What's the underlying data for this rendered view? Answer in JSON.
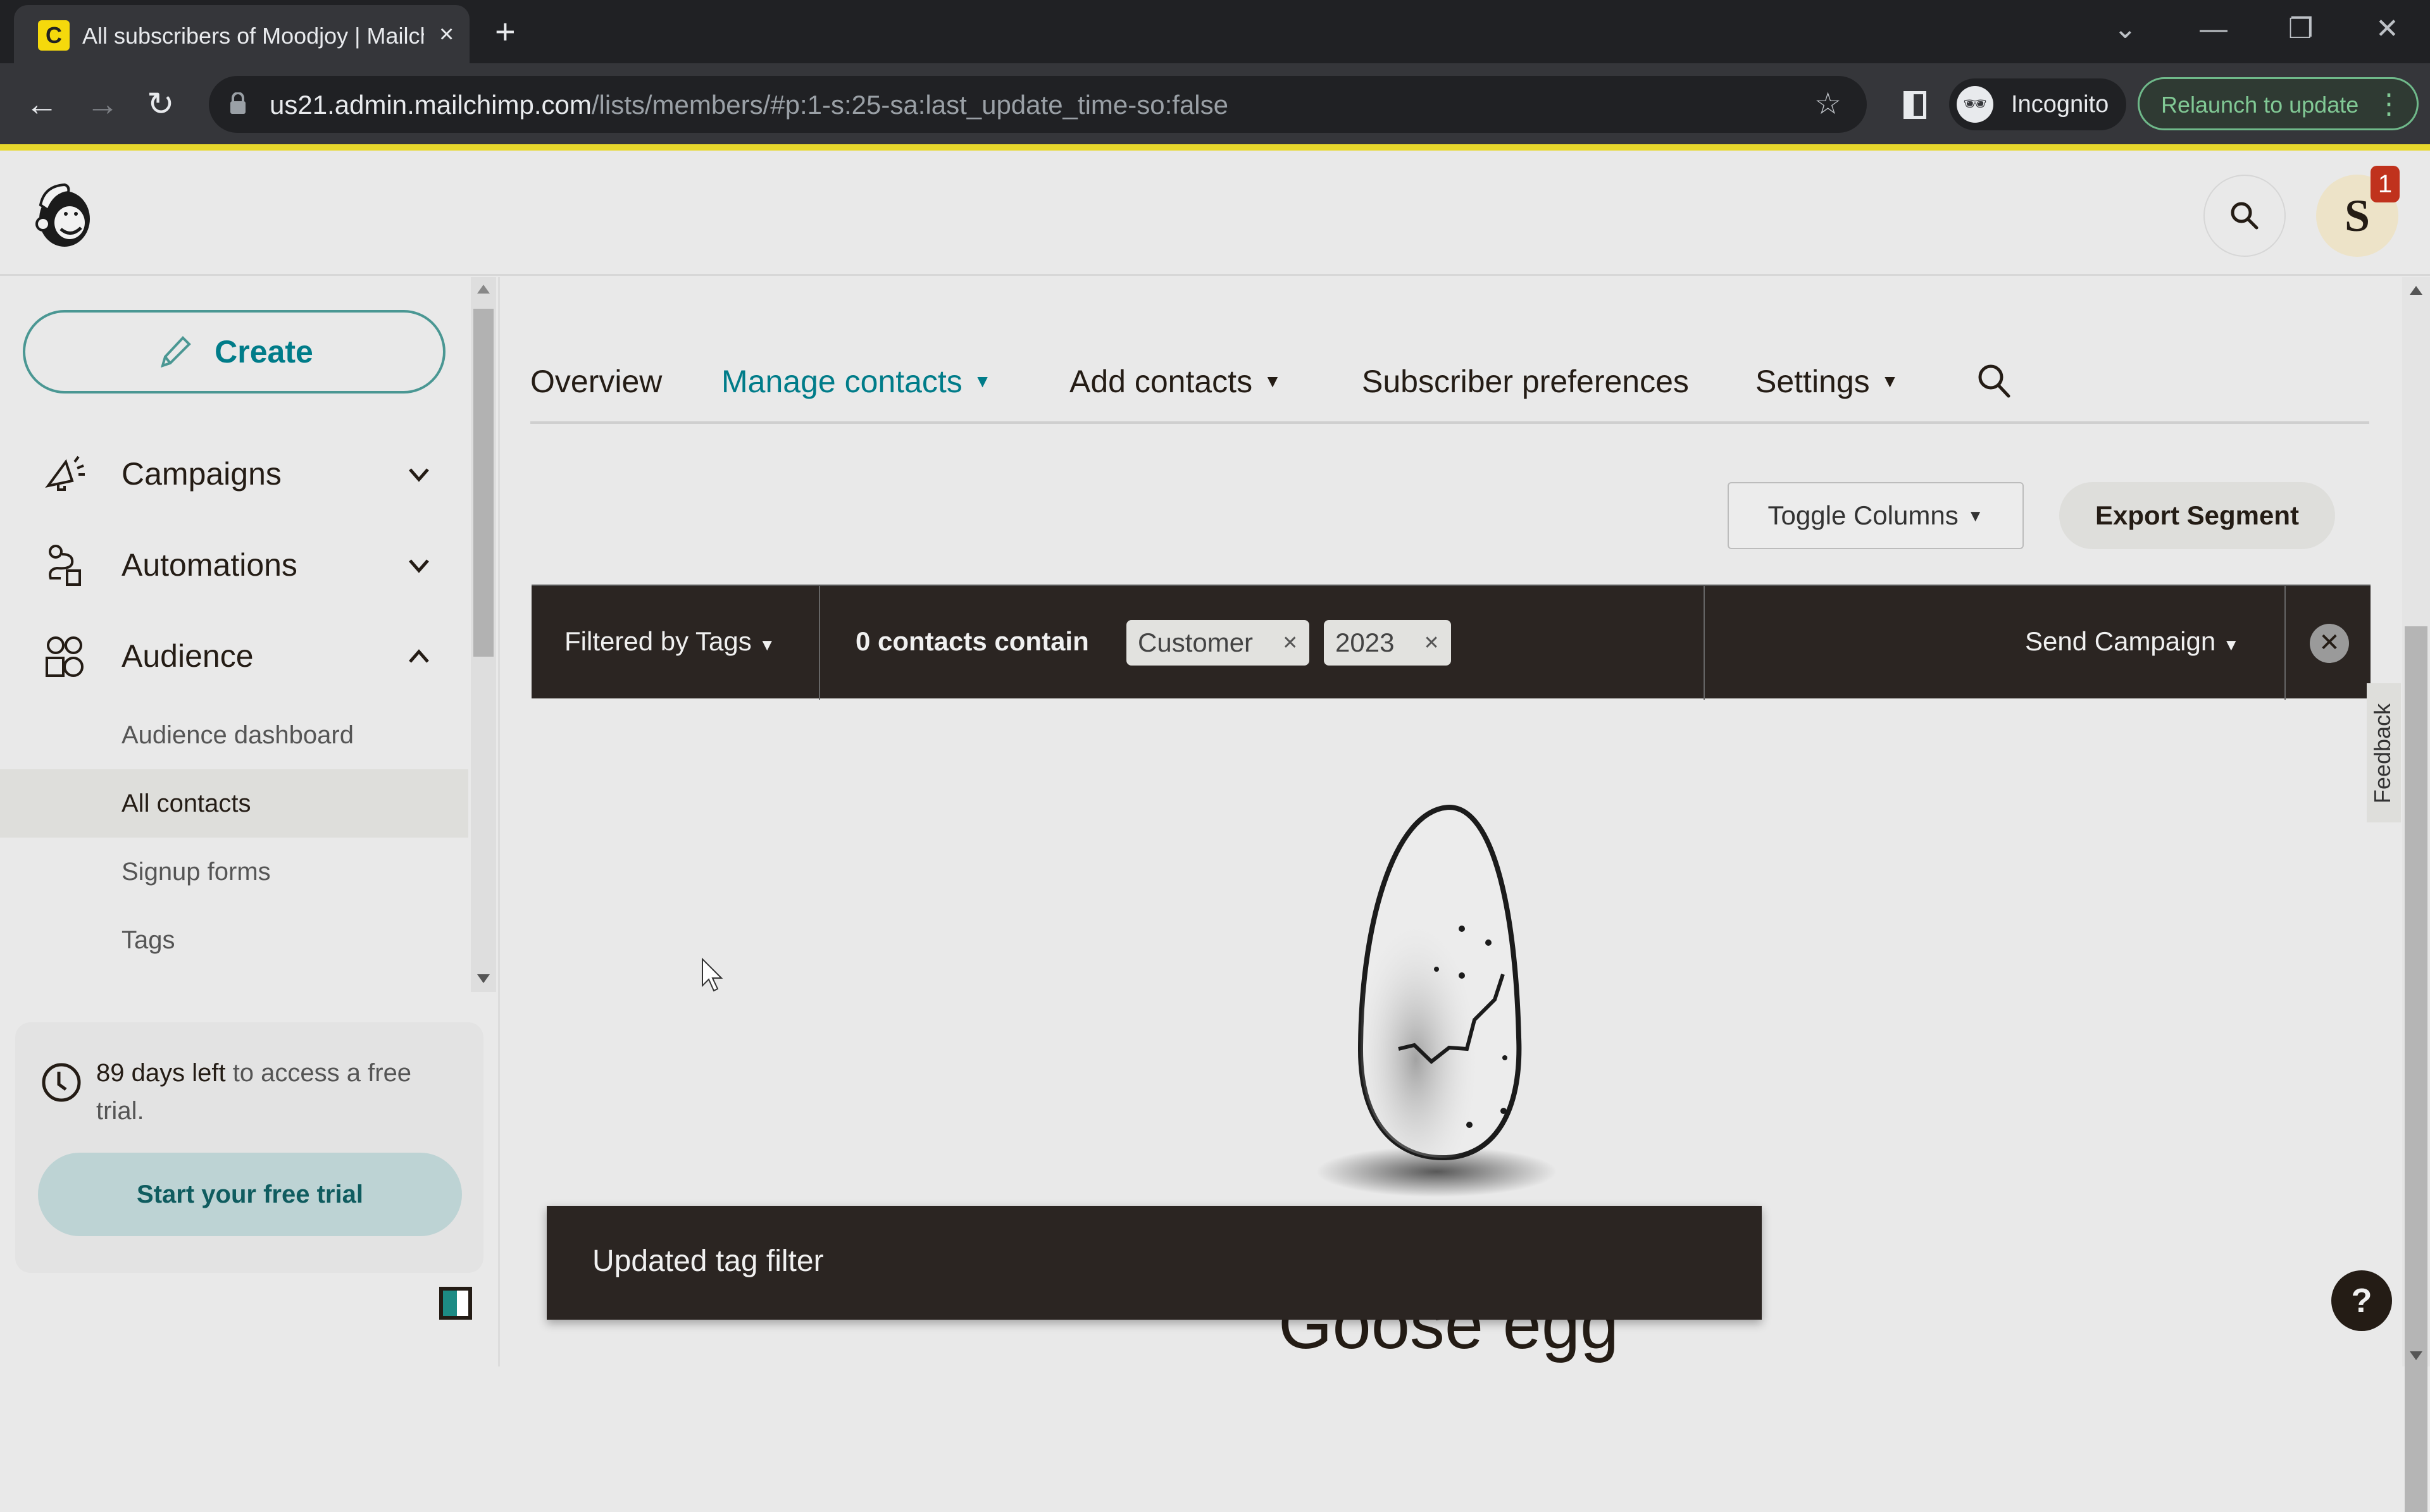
{
  "browser": {
    "tab_title": "All subscribers of Moodjoy | Mailchimp",
    "new_tab_label": "+",
    "url_host": "us21.admin.mailchimp.com",
    "url_path": "/lists/members/#p:1-s:25-sa:last_update_time-so:false",
    "incognito_label": "Incognito",
    "relaunch_label": "Relaunch to update",
    "accent_color": "#e7d82c"
  },
  "header": {
    "avatar_initial": "S",
    "notification_count": "1"
  },
  "sidebar": {
    "create_label": "Create",
    "nav": [
      {
        "label": "Campaigns",
        "icon": "megaphone-icon",
        "expanded": false
      },
      {
        "label": "Automations",
        "icon": "automation-flow-icon",
        "expanded": false
      },
      {
        "label": "Audience",
        "icon": "audience-icon",
        "expanded": true
      }
    ],
    "audience_sub": [
      {
        "label": "Audience dashboard",
        "active": false
      },
      {
        "label": "All contacts",
        "active": true
      },
      {
        "label": "Signup forms",
        "active": false
      },
      {
        "label": "Tags",
        "active": false
      }
    ],
    "trial": {
      "days_left": "89 days left",
      "rest": " to access a free trial.",
      "button": "Start your free trial"
    }
  },
  "subnav": {
    "items": [
      {
        "label": "Overview",
        "active": false,
        "dropdown": false
      },
      {
        "label": "Manage contacts",
        "active": true,
        "dropdown": true
      },
      {
        "label": "Add contacts",
        "active": false,
        "dropdown": true
      },
      {
        "label": "Subscriber preferences",
        "active": false,
        "dropdown": false
      },
      {
        "label": "Settings",
        "active": false,
        "dropdown": true
      }
    ]
  },
  "actions": {
    "toggle_columns": "Toggle Columns",
    "export_segment": "Export Segment"
  },
  "filter": {
    "mode": "Filtered by Tags",
    "count_text": "0 contacts contain",
    "tags": [
      "Customer",
      "2023"
    ],
    "send_campaign": "Send Campaign"
  },
  "empty_state": {
    "title": "Goose egg"
  },
  "toast": {
    "message": "Updated tag filter"
  },
  "feedback_label": "Feedback",
  "help_label": "?",
  "colors": {
    "brand_teal": "#007c89",
    "dark_bar": "#2b2522",
    "badge_red": "#c0321d"
  }
}
